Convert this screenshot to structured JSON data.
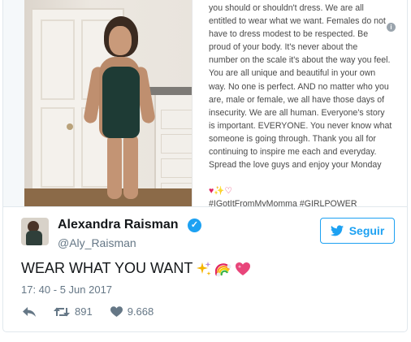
{
  "media": {
    "note_text": "you should or shouldn't dress. We are all\nentitled to wear what we want. Females do not\nhave to dress modest to be respected. Be\nproud of your body. It's never about the\nnumber on the scale it's about the way you feel.\nYou are all unique and beautiful in your own\nway. No one is perfect. AND no matter who you\nare, male or female, we all have those days of\ninsecurity. We are all human. Everyone's story\nis important. EVERYONE. You never know what\nsomeone is going through. Thank you all for\ncontinuing to inspire me each and everyday.\nSpread the love guys and enjoy your Monday",
    "note_tags": "#IGotItFromMyMomma #GIRLPOWER",
    "info_icon": "i"
  },
  "author": {
    "name": "Alexandra Raisman",
    "handle": "@Aly_Raisman",
    "verified_icon": "✓"
  },
  "follow_button": {
    "label": "Seguir"
  },
  "tweet": {
    "text": "WEAR WHAT YOU WANT",
    "timestamp": "17: 40 - 5 Jun 2017"
  },
  "stats": {
    "retweets": "891",
    "likes": "9.668"
  },
  "colors": {
    "accent": "#1da1f2",
    "muted": "#657786"
  }
}
